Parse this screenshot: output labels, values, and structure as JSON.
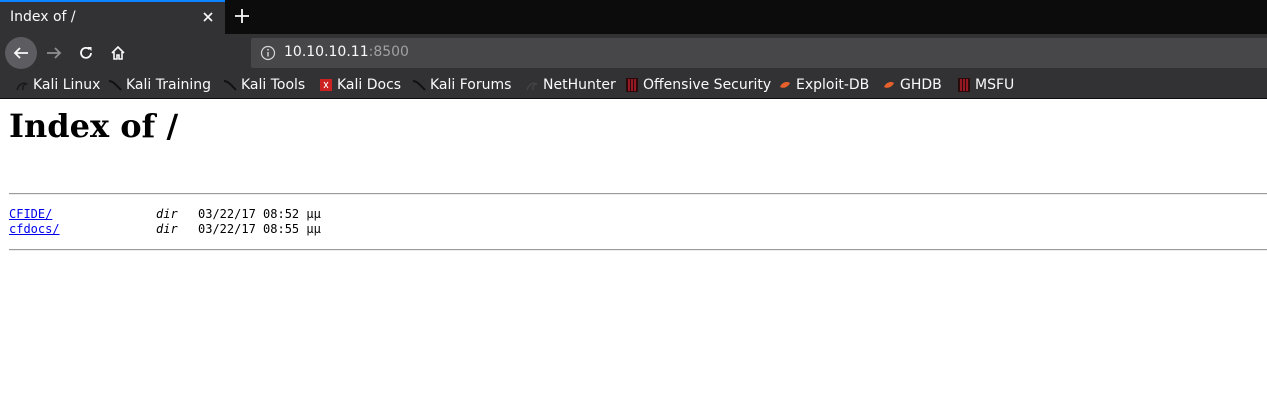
{
  "browser": {
    "tab": {
      "title": "Index of /"
    },
    "url": {
      "host": "10.10.10.11",
      "port": ":8500"
    },
    "bookmarks": [
      {
        "label": "Kali Linux",
        "icon": "kali-dragon-icon"
      },
      {
        "label": "Kali Training",
        "icon": "kali-dragon-icon"
      },
      {
        "label": "Kali Tools",
        "icon": "kali-dragon-icon"
      },
      {
        "label": "Kali Docs",
        "icon": "kali-docs-icon"
      },
      {
        "label": "Kali Forums",
        "icon": "kali-dragon-icon"
      },
      {
        "label": "NetHunter",
        "icon": "nethunter-icon"
      },
      {
        "label": "Offensive Security",
        "icon": "offsec-icon"
      },
      {
        "label": "Exploit-DB",
        "icon": "exploit-db-icon"
      },
      {
        "label": "GHDB",
        "icon": "exploit-db-icon"
      },
      {
        "label": "MSFU",
        "icon": "offsec-icon"
      }
    ],
    "colors": {
      "tab_accent": "#0a84ff",
      "toolbar": "#323234",
      "tabstrip": "#0c0c0d"
    }
  },
  "page": {
    "title": "Index of /",
    "entries": [
      {
        "name": "CFIDE/",
        "type": "dir",
        "date": "03/22/17 08:52 μμ"
      },
      {
        "name": "cfdocs/",
        "type": "dir",
        "date": "03/22/17 08:55 μμ"
      }
    ]
  }
}
